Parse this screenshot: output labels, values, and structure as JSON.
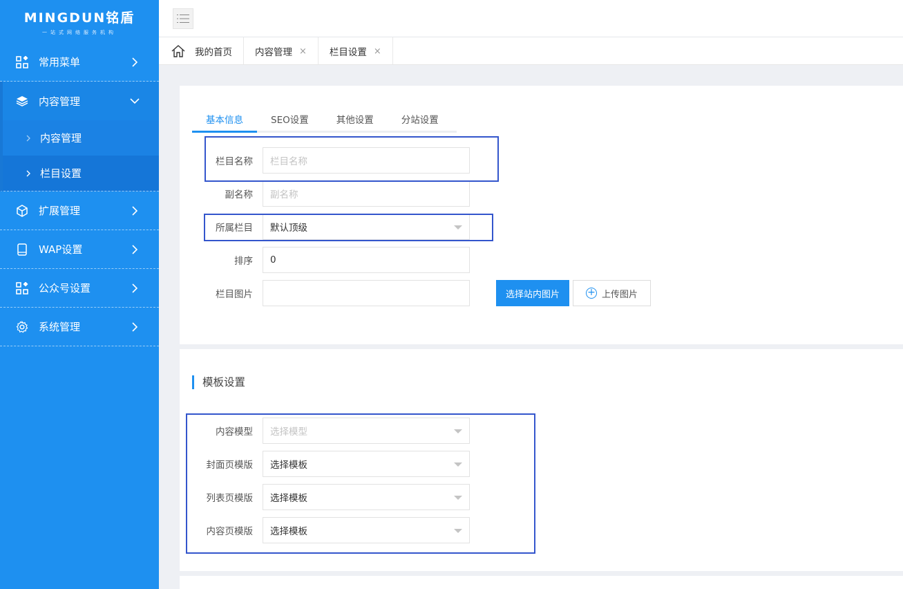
{
  "logo": {
    "main": "MINGDUN铭盾",
    "sub": "一站式网络服务机构"
  },
  "sidebar": {
    "items": [
      {
        "label": "常用菜单",
        "icon": "grid-icon"
      },
      {
        "label": "内容管理",
        "icon": "layers-icon",
        "open": true,
        "children": [
          {
            "label": "内容管理"
          },
          {
            "label": "栏目设置",
            "active": true
          }
        ]
      },
      {
        "label": "扩展管理",
        "icon": "cube-icon"
      },
      {
        "label": "WAP设置",
        "icon": "tablet-icon"
      },
      {
        "label": "公众号设置",
        "icon": "grid-icon"
      },
      {
        "label": "系统管理",
        "icon": "gear-icon"
      }
    ]
  },
  "tabs": [
    {
      "label": "我的首页"
    },
    {
      "label": "内容管理",
      "close": "×"
    },
    {
      "label": "栏目设置",
      "close": "×"
    }
  ],
  "form_tabs": [
    "基本信息",
    "SEO设置",
    "其他设置",
    "分站设置"
  ],
  "basic": {
    "name_label": "栏目名称",
    "name_placeholder": "栏目名称",
    "subname_label": "副名称",
    "subname_placeholder": "副名称",
    "parent_label": "所属栏目",
    "parent_value": "默认顶级",
    "sort_label": "排序",
    "sort_value": "0",
    "image_label": "栏目图片",
    "choose_btn": "选择站内图片",
    "upload_btn": "上传图片"
  },
  "template": {
    "title": "模板设置",
    "model_label": "内容模型",
    "model_value": "选择模型",
    "cover_label": "封面页模版",
    "cover_value": "选择模板",
    "list_label": "列表页模版",
    "list_value": "选择模板",
    "content_label": "内容页模版",
    "content_value": "选择模板"
  },
  "colors": {
    "sidebar": "#1e90f0",
    "accent": "#1e90f0",
    "highlight": "#3355cc"
  }
}
